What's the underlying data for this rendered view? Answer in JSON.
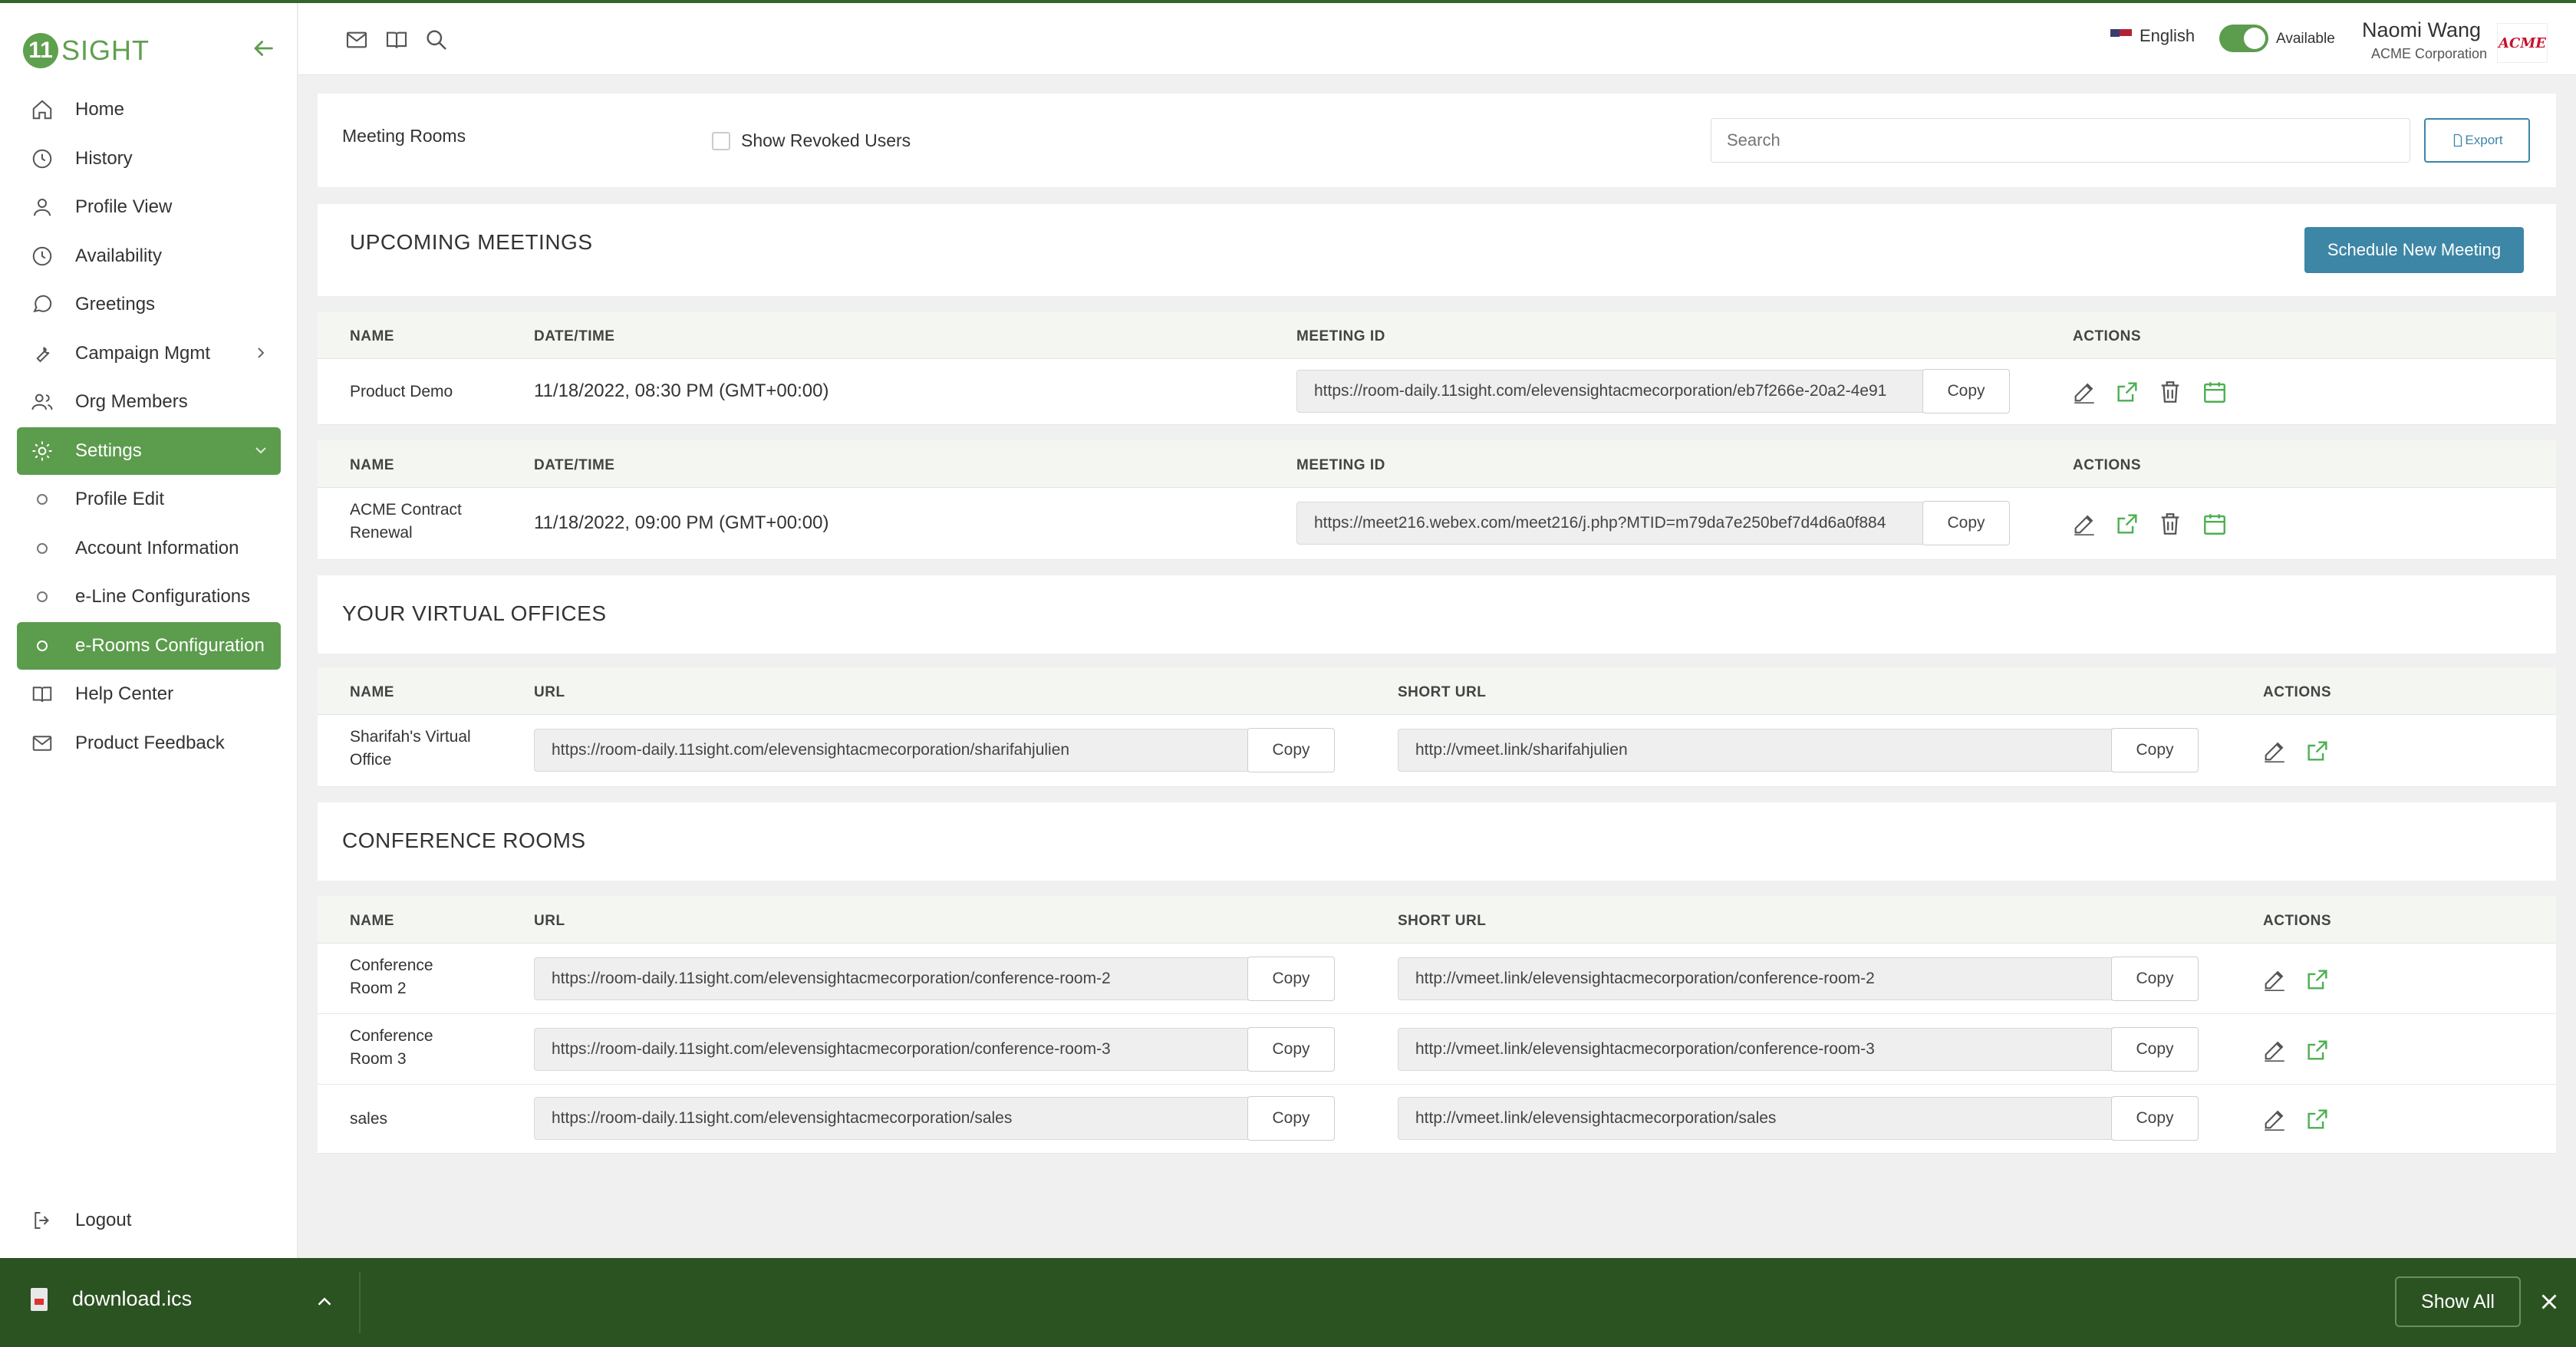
{
  "app": {
    "logo_mark": "11",
    "logo_text": "SIGHT"
  },
  "sidebar": {
    "items": [
      {
        "label": "Home",
        "icon": "home-icon"
      },
      {
        "label": "History",
        "icon": "clock-icon"
      },
      {
        "label": "Profile View",
        "icon": "person-icon"
      },
      {
        "label": "Availability",
        "icon": "clock-icon"
      },
      {
        "label": "Greetings",
        "icon": "chat-bubble-icon"
      },
      {
        "label": "Campaign Mgmt",
        "icon": "wrench-icon"
      },
      {
        "label": "Org Members",
        "icon": "people-icon"
      },
      {
        "label": "Settings",
        "icon": "gear-icon"
      },
      {
        "label": "Profile Edit"
      },
      {
        "label": "Account Information"
      },
      {
        "label": "e-Line Configurations"
      },
      {
        "label": "e-Rooms Configuration"
      },
      {
        "label": "Help Center",
        "icon": "book-icon"
      },
      {
        "label": "Product Feedback",
        "icon": "mail-icon"
      }
    ],
    "active": "e-Rooms Configuration",
    "logout": "Logout"
  },
  "topbar": {
    "language": "English",
    "status": "Available",
    "status_on": true,
    "user_name": "Naomi Wang",
    "user_org": "ACME Corporation",
    "avatar_text": "ACME"
  },
  "header": {
    "title": "Meeting Rooms",
    "show_revoked_label": "Show Revoked Users",
    "search_placeholder": "Search",
    "export_label": "Export"
  },
  "upcoming": {
    "title": "UPCOMING MEETINGS",
    "schedule_label": "Schedule New Meeting",
    "columns": [
      "NAME",
      "DATE/TIME",
      "MEETING ID",
      "ACTIONS"
    ],
    "rows": [
      {
        "name": "Product Demo",
        "datetime": "11/18/2022, 08:30 PM (GMT+00:00)",
        "meeting_id": "https://room-daily.11sight.com/elevensightacmecorporation/eb7f266e-20a2-4e91",
        "copy": "Copy"
      },
      {
        "name": "ACME Contract Renewal",
        "datetime": "11/18/2022, 09:00 PM (GMT+00:00)",
        "meeting_id": "https://meet216.webex.com/meet216/j.php?MTID=m79da7e250bef7d4d6a0f884",
        "copy": "Copy"
      }
    ]
  },
  "virtual_offices": {
    "title": "YOUR VIRTUAL OFFICES",
    "columns": [
      "NAME",
      "URL",
      "SHORT URL",
      "ACTIONS"
    ],
    "rows": [
      {
        "name": "Sharifah's Virtual Office",
        "url": "https://room-daily.11sight.com/elevensightacmecorporation/sharifahjulien",
        "short_url": "http://vmeet.link/sharifahjulien",
        "copy": "Copy"
      }
    ]
  },
  "conference_rooms": {
    "title": "CONFERENCE ROOMS",
    "columns": [
      "NAME",
      "URL",
      "SHORT URL",
      "ACTIONS"
    ],
    "rows": [
      {
        "name": "Conference Room 2",
        "url": "https://room-daily.11sight.com/elevensightacmecorporation/conference-room-2",
        "short_url": "http://vmeet.link/elevensightacmecorporation/conference-room-2",
        "copy": "Copy"
      },
      {
        "name": "Conference Room 3",
        "url": "https://room-daily.11sight.com/elevensightacmecorporation/conference-room-3",
        "short_url": "http://vmeet.link/elevensightacmecorporation/conference-room-3",
        "copy": "Copy"
      },
      {
        "name": "sales",
        "url": "https://room-daily.11sight.com/elevensightacmecorporation/sales",
        "short_url": "http://vmeet.link/elevensightacmecorporation/sales",
        "copy": "Copy"
      }
    ]
  },
  "download_bar": {
    "filename": "download.ics",
    "show_all": "Show All"
  },
  "colors": {
    "brand_green": "#5c9c4d",
    "accent_blue": "#3d86a6",
    "download_bar": "#2b5221",
    "action_green": "#4caf50"
  }
}
